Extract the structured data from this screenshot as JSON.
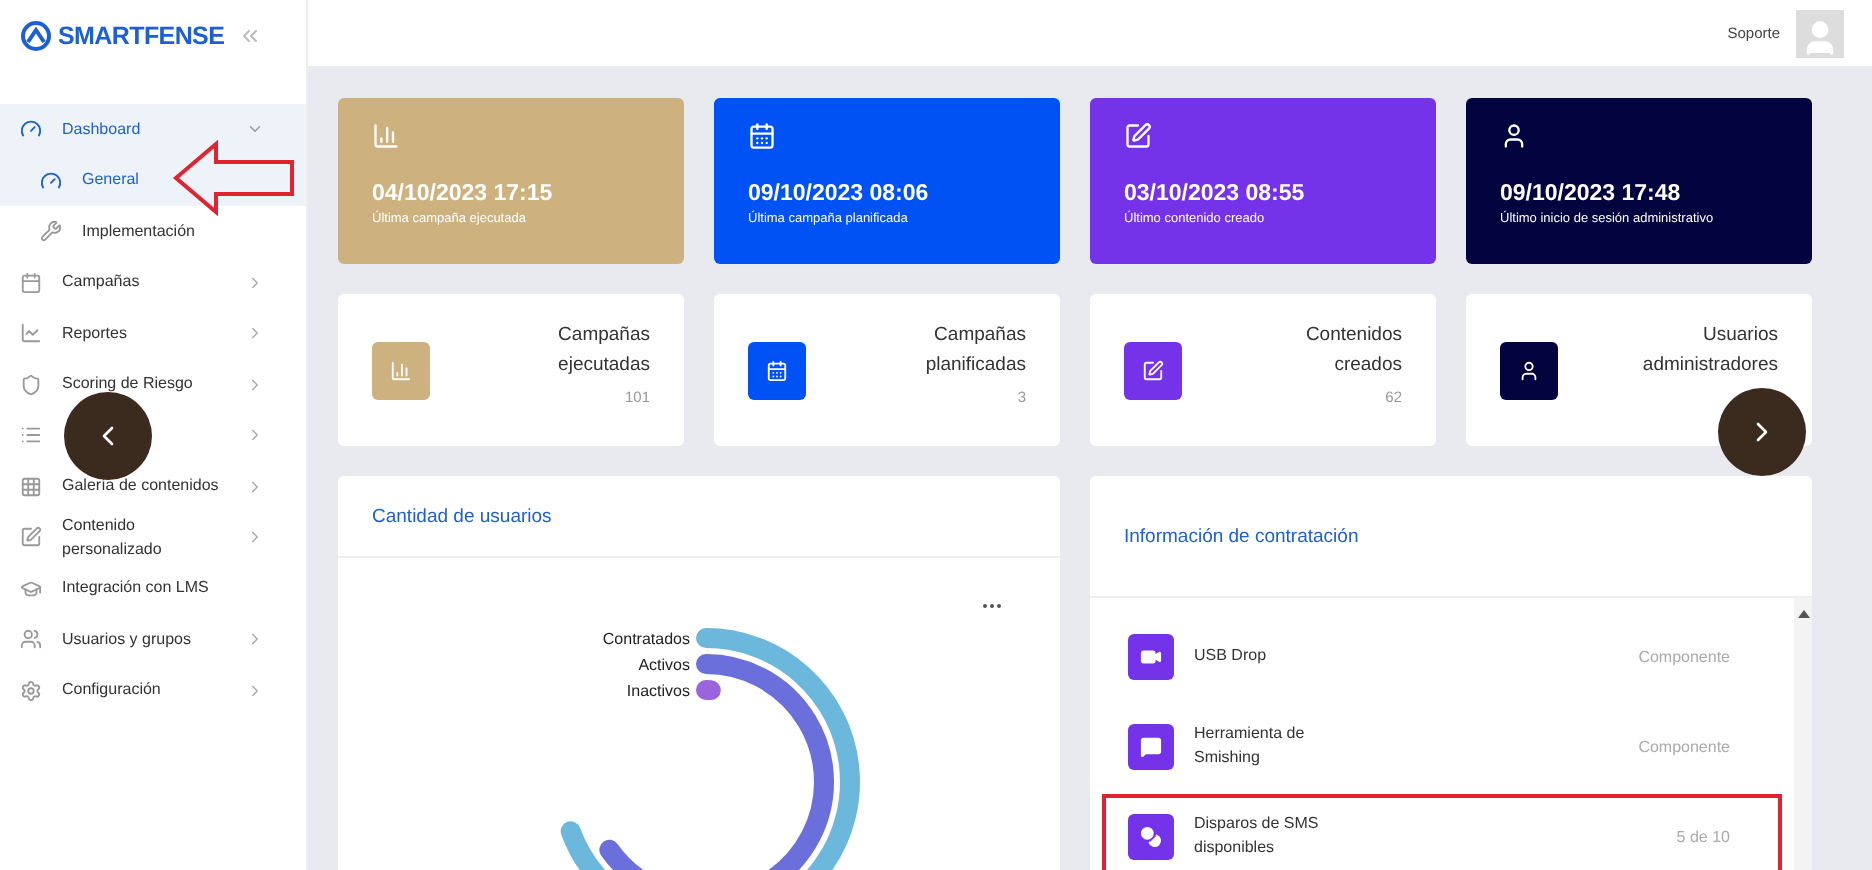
{
  "sidebar": {
    "logo": "SMARTFENSE",
    "items": [
      {
        "label": "Dashboard",
        "kind": "group",
        "expanded": true,
        "selected": true,
        "children": [
          {
            "label": "General",
            "selected": true
          },
          {
            "label": "Implementación",
            "selected": false
          }
        ]
      },
      {
        "label": "Campañas",
        "kind": "group",
        "expanded": false,
        "selected": false
      },
      {
        "label": "Reportes",
        "kind": "group",
        "expanded": false,
        "selected": false
      },
      {
        "label": "Scoring de Riesgo",
        "kind": "group",
        "expanded": false,
        "selected": false
      },
      {
        "kind": "group",
        "expanded": false,
        "selected": false
      },
      {
        "label": "Galería de contenidos",
        "kind": "group",
        "expanded": false,
        "selected": false
      },
      {
        "label": "Contenido personalizado",
        "kind": "group",
        "expanded": false,
        "selected": false
      },
      {
        "label": "Integración con LMS",
        "kind": "link",
        "selected": false
      },
      {
        "label": "Usuarios y grupos",
        "kind": "group",
        "expanded": false,
        "selected": false
      },
      {
        "label": "Configuración",
        "kind": "group",
        "expanded": false,
        "selected": false
      }
    ]
  },
  "header": {
    "user": "Soporte"
  },
  "highlight_cards": [
    {
      "value": "04/10/2023 17:15",
      "label": "Última campaña ejecutada",
      "color": "#cdb27f"
    },
    {
      "value": "09/10/2023 08:06",
      "label": "Última campaña planificada",
      "color": "#0052f5"
    },
    {
      "value": "03/10/2023 08:55",
      "label": "Último contenido creado",
      "color": "#7433e8"
    },
    {
      "value": "09/10/2023 17:48",
      "label": "Último inicio de sesión administrativo",
      "color": "#02033f"
    }
  ],
  "count_cards": [
    {
      "title": "Campañas ejecutadas",
      "count": "101",
      "color": "#cdb27f"
    },
    {
      "title": "Campañas planificadas",
      "count": "3",
      "color": "#0052f5"
    },
    {
      "title": "Contenidos creados",
      "count": "62",
      "color": "#7433e8"
    },
    {
      "title": "Usuarios administradores",
      "color": "#02033f"
    }
  ],
  "users_panel": {
    "title": "Cantidad de usuarios",
    "series": [
      {
        "name": "Contratados",
        "color": "#6cb8dc"
      },
      {
        "name": "Activos",
        "color": "#6a6fdb"
      },
      {
        "name": "Inactivos",
        "color": "#9b63dc"
      }
    ]
  },
  "contract_panel": {
    "title": "Información de contratación",
    "rows": [
      {
        "name": "USB Drop",
        "value": "Componente",
        "highlighted": false
      },
      {
        "name": "Herramienta de Smishing",
        "value": "Componente",
        "highlighted": false
      },
      {
        "name": "Disparos de SMS disponibles",
        "value": "5 de 10",
        "highlighted": true
      }
    ]
  }
}
